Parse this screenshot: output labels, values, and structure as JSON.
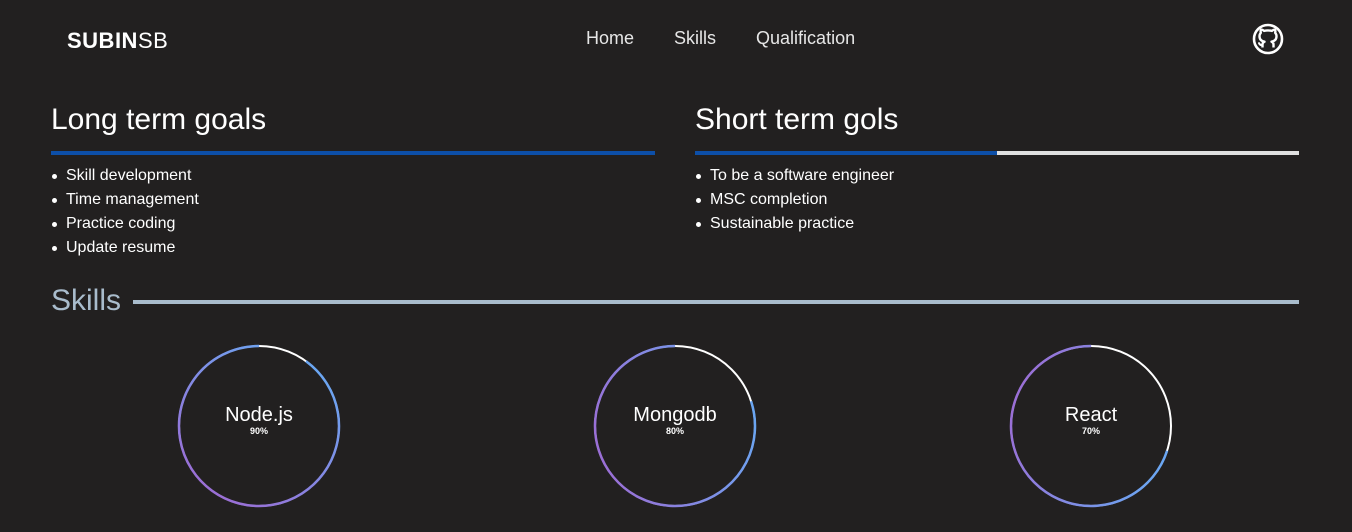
{
  "brand": {
    "bold": "SUBIN",
    "light": "SB"
  },
  "nav": {
    "links": [
      "Home",
      "Skills",
      "Qualification"
    ]
  },
  "icons": {
    "github": "github-icon"
  },
  "long_term": {
    "title": "Long term goals",
    "progress": 1.0,
    "items": [
      "Skill development",
      "Time management",
      "Practice coding",
      "Update resume"
    ]
  },
  "short_term": {
    "title": "Short term gols",
    "progress": 0.5,
    "items": [
      "To be a software engineer",
      "MSC completion",
      "Sustainable practice"
    ]
  },
  "skills": {
    "title": "Skills",
    "items": [
      {
        "name": "Node.js",
        "percent_label": "90%",
        "value": 0.9
      },
      {
        "name": "Mongodb",
        "percent_label": "80%",
        "value": 0.8
      },
      {
        "name": "React",
        "percent_label": "70%",
        "value": 0.7
      }
    ]
  },
  "colors": {
    "background": "#222020",
    "accent_blue": "#0d4fa8",
    "skills_line": "#a9bccc",
    "ring_purple": "#9a6fd6",
    "ring_blue": "#6aa6f2"
  }
}
